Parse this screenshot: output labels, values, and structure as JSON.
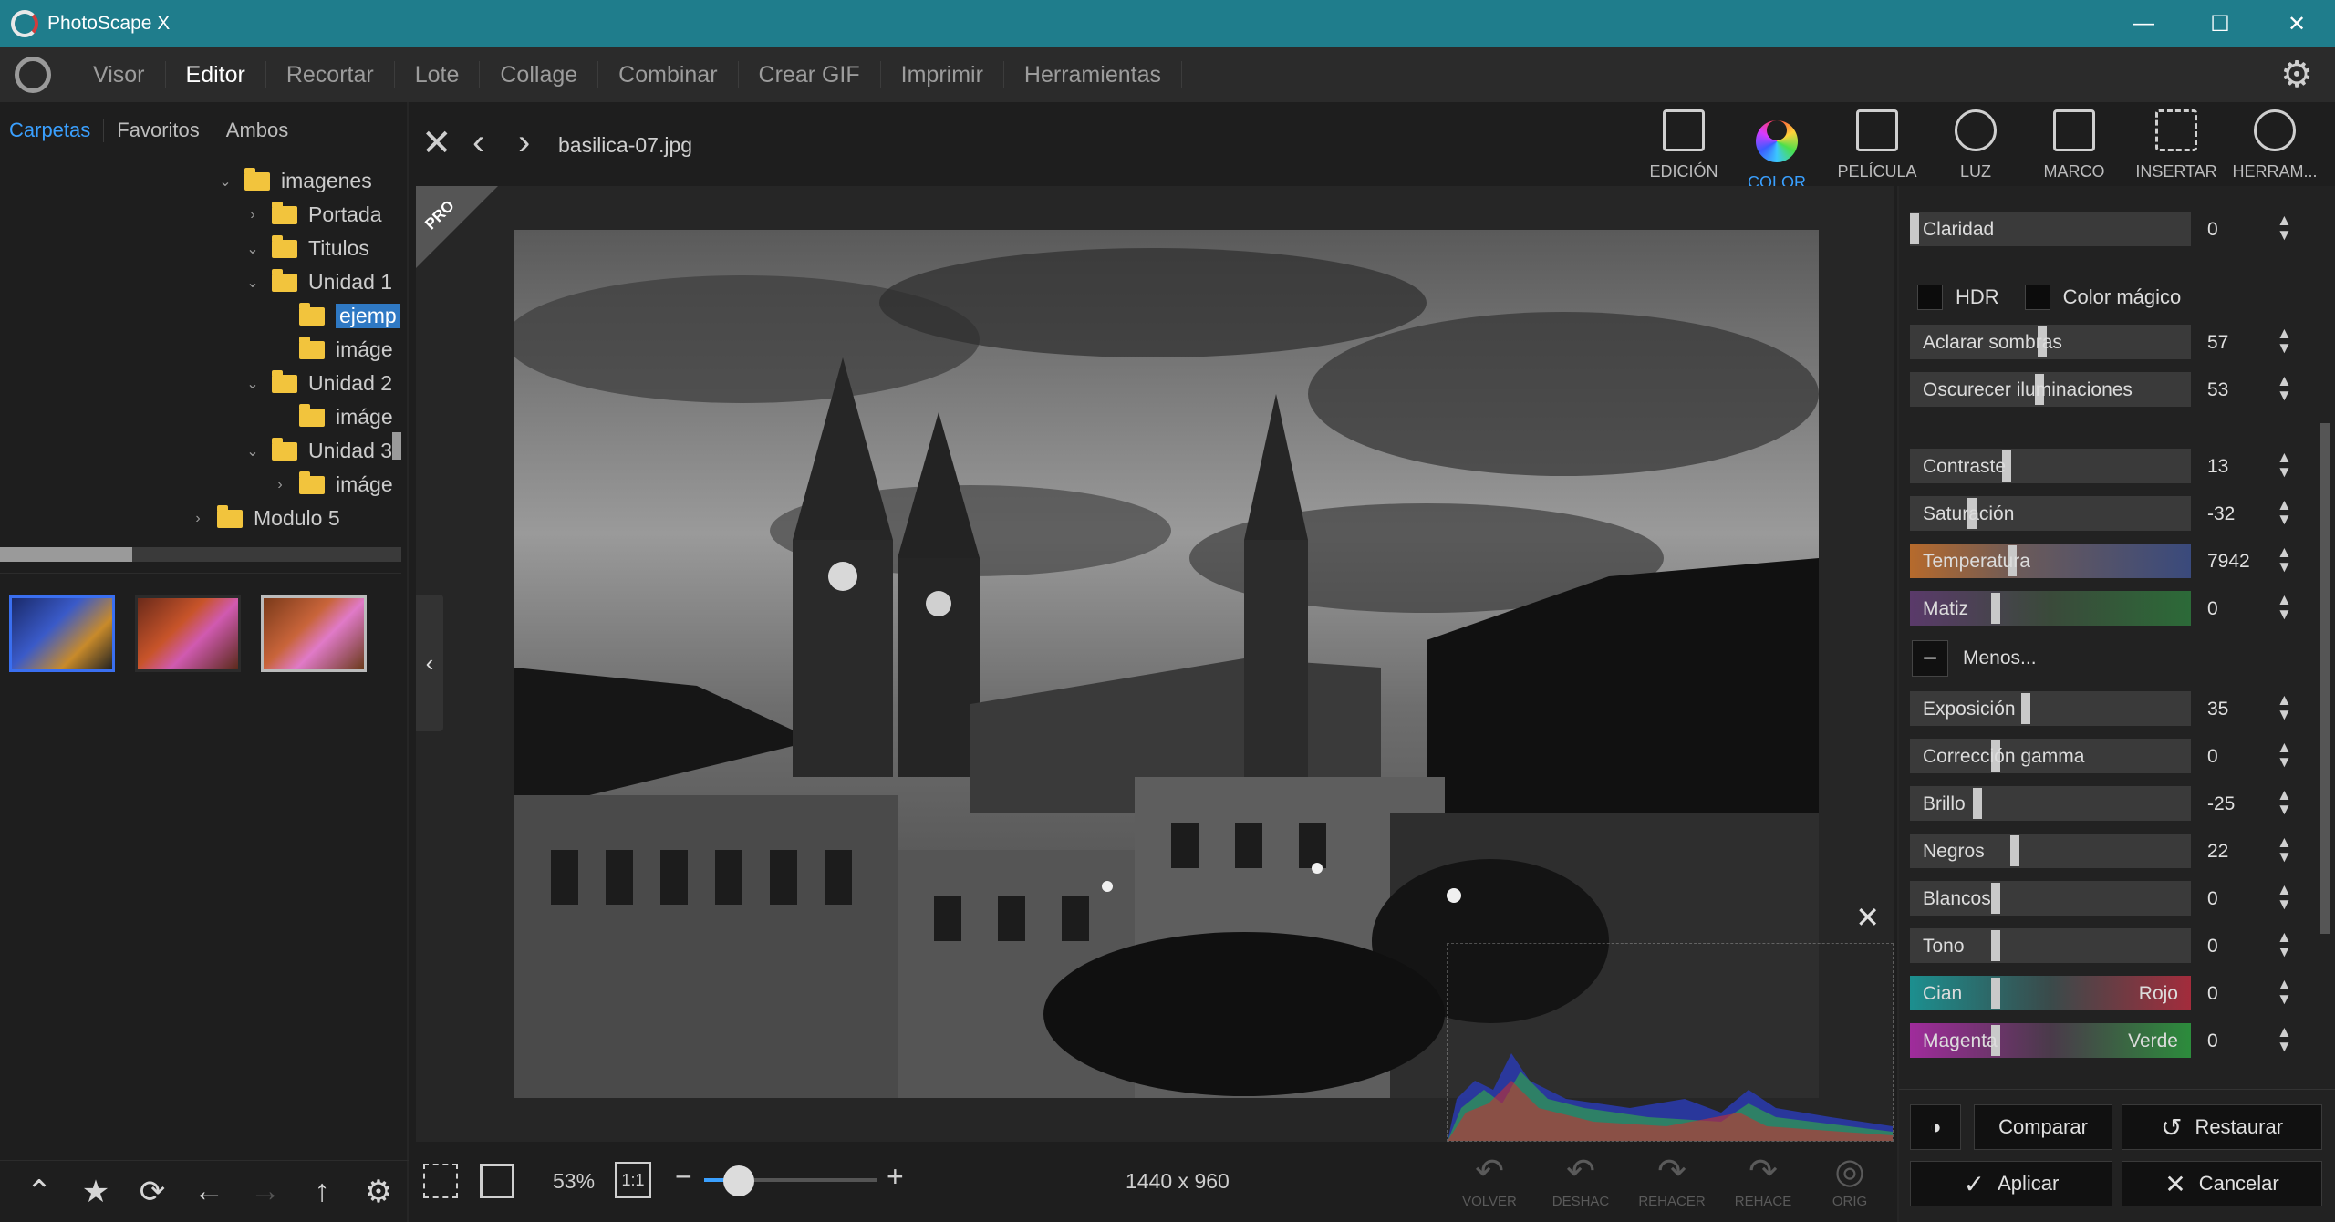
{
  "app": {
    "title": "PhotoScape X"
  },
  "window_controls": {
    "minimize": "—",
    "maximize": "☐",
    "close": "✕"
  },
  "menu": {
    "items": [
      "Visor",
      "Editor",
      "Recortar",
      "Lote",
      "Collage",
      "Combinar",
      "Crear GIF",
      "Imprimir",
      "Herramientas"
    ],
    "active": "Editor"
  },
  "left_panel": {
    "tabs": [
      "Carpetas",
      "Favoritos",
      "Ambos"
    ],
    "active_tab": "Carpetas",
    "tree": [
      {
        "label": "imagenes",
        "chevron": "⌄"
      },
      {
        "label": "Portada",
        "chevron": "›"
      },
      {
        "label": "Titulos",
        "chevron": "⌄"
      },
      {
        "label": "Unidad 1",
        "chevron": "⌄"
      },
      {
        "label": "ejemp",
        "chevron": "",
        "selected": true
      },
      {
        "label": "imáge",
        "chevron": ""
      },
      {
        "label": "Unidad 2",
        "chevron": "⌄"
      },
      {
        "label": "imáge",
        "chevron": ""
      },
      {
        "label": "Unidad 3",
        "chevron": "⌄"
      },
      {
        "label": "imáge",
        "chevron": "›"
      },
      {
        "label": "Modulo 5",
        "chevron": "›"
      }
    ],
    "thumbnails": [
      "basilica",
      "viajeros-1",
      "viajeros-2"
    ],
    "bottom_icons": [
      "chevron-up-icon",
      "star-icon",
      "refresh-icon",
      "arrow-left-icon",
      "arrow-right-icon",
      "arrow-up-icon",
      "gear-icon"
    ]
  },
  "editor": {
    "file_name": "basilica-07.jpg",
    "tool_tabs": [
      "EDICIÓN",
      "COLOR",
      "PELÍCULA",
      "LUZ",
      "MARCO",
      "INSERTAR",
      "HERRAM..."
    ],
    "active_tool": "COLOR",
    "pro_badge": "PRO",
    "zoom": "53%",
    "one_to_one": "1:1",
    "zoom_level": 0.2,
    "image_size": "1440 x 960",
    "history_buttons": [
      "VOLVER",
      "DESHAC",
      "REHACER",
      "REHACE",
      "ORIG"
    ]
  },
  "adjustments": {
    "claridad": {
      "label": "Claridad",
      "value": "0"
    },
    "hdr_label": "HDR",
    "magic_color_label": "Color mágico",
    "sliders_a": [
      {
        "label": "Aclarar sombras",
        "value": "57",
        "pos": 0.47
      },
      {
        "label": "Oscurecer iluminaciones",
        "value": "53",
        "pos": 0.46
      }
    ],
    "sliders_b": [
      {
        "label": "Contraste",
        "value": "13",
        "pos": 0.34
      },
      {
        "label": "Saturación",
        "value": "-32",
        "pos": 0.21
      },
      {
        "label": "Temperatura",
        "value": "7942",
        "pos": 0.36
      },
      {
        "label": "Matiz",
        "value": "0",
        "pos": 0.3
      }
    ],
    "menos_label": "Menos...",
    "sliders_c": [
      {
        "label": "Exposición",
        "value": "35",
        "pos": 0.41
      },
      {
        "label": "Corrección gamma",
        "value": "0",
        "pos": 0.3
      },
      {
        "label": "Brillo",
        "value": "-25",
        "pos": 0.23
      },
      {
        "label": "Negros",
        "value": "22",
        "pos": 0.37
      },
      {
        "label": "Blancos",
        "value": "0",
        "pos": 0.3
      },
      {
        "label": "Tono",
        "value": "0",
        "pos": 0.3
      },
      {
        "label": "Cian",
        "label_right": "Rojo",
        "value": "0",
        "pos": 0.3
      },
      {
        "label": "Magenta",
        "label_right": "Verde",
        "value": "0",
        "pos": 0.3
      }
    ],
    "buttons": {
      "compare": "Comparar",
      "restore": "Restaurar",
      "apply": "Aplicar",
      "cancel": "Cancelar"
    }
  },
  "colors": {
    "titlebar": "#1f7d8c",
    "accent": "#3aa0ff"
  }
}
